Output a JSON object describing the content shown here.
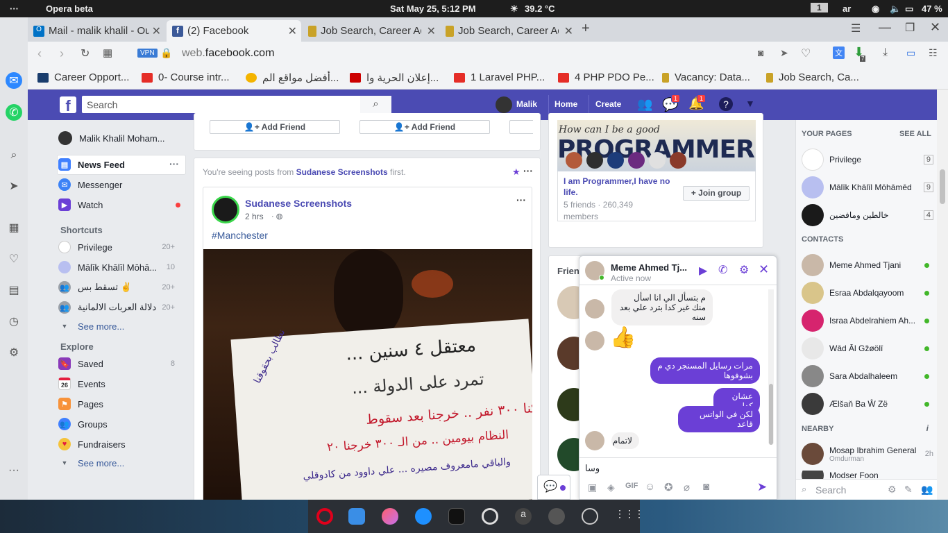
{
  "os": {
    "app": "Opera beta",
    "datetime": "Sat May 25,  5:12 PM",
    "weather": "39.2 °C",
    "workspace": "1",
    "lang": "ar",
    "battery": "47 %"
  },
  "tabs": [
    {
      "label": "Mail - malik khalil - Outlook"
    },
    {
      "label": "(2) Facebook"
    },
    {
      "label": "Job Search, Career Advice"
    },
    {
      "label": "Job Search, Career Advice"
    }
  ],
  "address": {
    "vpn": "VPN",
    "url_prefix": "web.",
    "url_domain": "facebook.com",
    "ext_badge": "7"
  },
  "bookmarks": [
    "Career Opport...",
    "0- Course intr...",
    "أفضل مواقع الم...",
    "إعلان الحرية وا...",
    "1 Laravel PHP...",
    "4 PHP PDO Pe...",
    "Vacancy: Data...",
    "Job Search, Ca..."
  ],
  "fb": {
    "search_placeholder": "Search",
    "user": "Malik",
    "home": "Home",
    "create": "Create",
    "msg_badge": "1",
    "notif_badge": "1"
  },
  "left": {
    "profile": "Malik Khalil Moham...",
    "nav": [
      {
        "label": "News Feed"
      },
      {
        "label": "Messenger"
      },
      {
        "label": "Watch"
      }
    ],
    "shortcuts_title": "Shortcuts",
    "shortcuts": [
      {
        "label": "Privilege",
        "count": "20+"
      },
      {
        "label": "Mālīk Khālīl Mōhā...",
        "count": "10"
      },
      {
        "label": "تسقط بس ✌",
        "count": "20+"
      },
      {
        "label": "دلالة العربات الالمانية",
        "count": "20+"
      }
    ],
    "see_more": "See more...",
    "explore_title": "Explore",
    "explore": [
      {
        "label": "Saved",
        "count": "8"
      },
      {
        "label": "Events",
        "count": ""
      },
      {
        "label": "Pages",
        "count": ""
      },
      {
        "label": "Groups",
        "count": ""
      },
      {
        "label": "Fundraisers",
        "count": ""
      }
    ],
    "see_more2": "See more...",
    "events_day": "26"
  },
  "feed": {
    "add_friend": "Add Friend",
    "seeing_prefix": "You're seeing posts from ",
    "seeing_page": "Sudanese Screenshots",
    "seeing_suffix": " first.",
    "post_author": "Sudanese Screenshots",
    "post_time": "2 hrs",
    "post_text": "#Manchester",
    "sign_lines": [
      "معتقل ٤ سنين ...",
      "تمرد على الدولة ...",
      "كنا ٣٠٠ نفر .. خرجنا بعد سقوط",
      "النظام بيومين .. من الـ ٣٠٠ خرجنا ٢٠",
      "والباقي مامعروف مصيره ... علي داوود من كادوقلي"
    ],
    "sign_corner": "نطالب بحقوقنا"
  },
  "group": {
    "banner_text": "How can I be a good",
    "banner_big": "PROGRAMMER?",
    "name": "I am Programmer,I have no life.",
    "meta": "5 friends · 260,349 members",
    "join": "Join group",
    "friends_label": "Frien"
  },
  "contacts": {
    "your_pages": "YOUR PAGES",
    "see_all": "SEE ALL",
    "pages": [
      {
        "name": "Privilege",
        "count": "9"
      },
      {
        "name": "Mālīk Khālīl Mōhāmēd",
        "count": "9"
      },
      {
        "name": "خالطين ومافضين",
        "count": "4"
      }
    ],
    "contacts_title": "CONTACTS",
    "people": [
      "Meme Ahmed Tjani",
      "Esraa Abdalqayoom",
      "Israa Abdelrahiem Ah...",
      "Wād Āl Gžøölī",
      "Sara Abdalhaleem",
      "Ælšaň Ba Ŵ Zë"
    ],
    "nearby_title": "NEARBY",
    "nearby": [
      {
        "name": "Mosap Ibrahim General",
        "sub": "Omdurman",
        "time": "2h"
      },
      {
        "name": "Modser Foon",
        "sub": "",
        "time": ""
      }
    ],
    "search_placeholder": "Search"
  },
  "chat": {
    "name": "Meme Ahmed Tj...",
    "status": "Active now",
    "messages": [
      {
        "dir": "in",
        "text": "م بتسأل الي انا اسأل منك غير كدا بترد علي بعد سنه"
      },
      {
        "dir": "in",
        "text": "👍"
      },
      {
        "dir": "out",
        "text": "مرات رسايل المسنجر دي م بشوفوها"
      },
      {
        "dir": "out",
        "text": "عشان كدا"
      },
      {
        "dir": "out",
        "text": "لكن في الواتس قاعد"
      },
      {
        "dir": "in",
        "text": "لاتمام"
      }
    ],
    "input_value": "وسا"
  },
  "colors": {
    "fb_blue": "#4b4bb3",
    "messenger_purple": "#6b3fd6",
    "online": "#42b72a",
    "notif_red": "#fa3e3e"
  }
}
